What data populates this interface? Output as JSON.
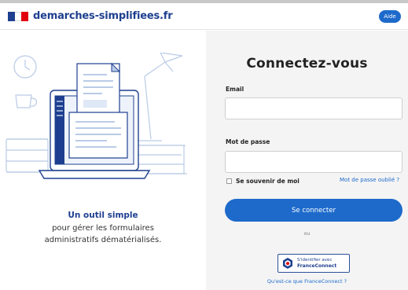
{
  "header": {
    "brand": "demarches-simplifiees.fr",
    "help_label": "Aide",
    "flag_colors": [
      "#1e3f8f",
      "#ffffff",
      "#e1000f"
    ]
  },
  "left": {
    "illustration": "document-laptop-illustration",
    "tagline_title": "Un outil simple",
    "tagline_line1": "pour gérer les formulaires",
    "tagline_line2": "administratifs dématérialisés."
  },
  "login": {
    "title": "Connectez-vous",
    "email_label": "Email",
    "email_value": "",
    "password_label": "Mot de passe",
    "password_value": "",
    "remember_label": "Se souvenir de moi",
    "remember_checked": false,
    "forgot_label": "Mot de passe oublié ?",
    "submit_label": "Se connecter",
    "or_label": "ou",
    "franceconnect_line1": "S'identifier avec",
    "franceconnect_line2": "FranceConnect",
    "franceconnect_help": "Qu'est-ce que FranceConnect ?"
  },
  "colors": {
    "primary": "#1d6acb",
    "brand": "#1e3f8f",
    "panel_bg": "#f4f4f4"
  }
}
